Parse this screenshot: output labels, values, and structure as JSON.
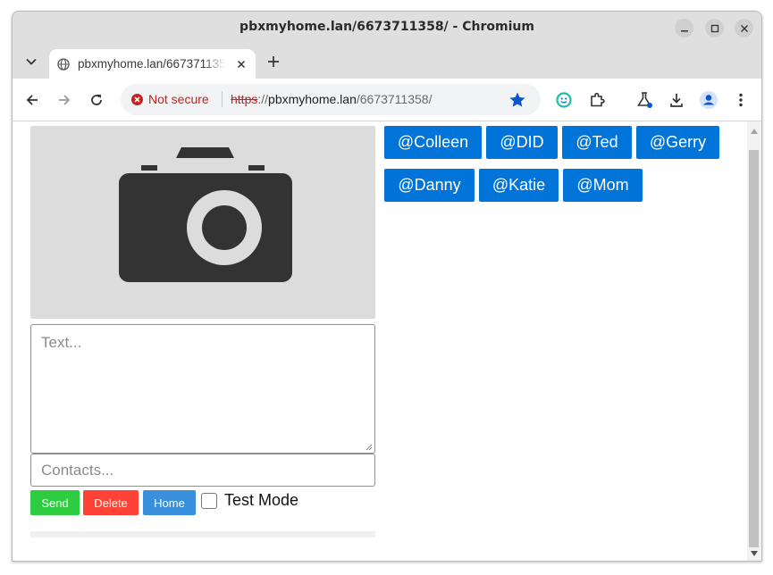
{
  "window": {
    "title": "pbxmyhome.lan/6673711358/ - Chromium",
    "controls": [
      "minimize-icon",
      "maximize-icon",
      "close-icon"
    ]
  },
  "tab": {
    "title": "pbxmyhome.lan/6673711358/"
  },
  "address_bar": {
    "security_label": "Not secure",
    "url_scheme": "https",
    "url_separator": "://",
    "url_host": "pbxmyhome.lan",
    "url_path": "/6673711358/"
  },
  "toolbar_icons": [
    "back-arrow-icon",
    "forward-arrow-icon",
    "reload-icon",
    "bookmark-star-icon",
    "extension-icon",
    "puzzle-extensions-icon",
    "labs-flask-icon",
    "download-icon",
    "profile-icon",
    "menu-kebab-icon"
  ],
  "form": {
    "text_placeholder": "Text...",
    "contacts_placeholder": "Contacts...",
    "send_label": "Send",
    "delete_label": "Delete",
    "home_label": "Home",
    "test_mode_label": "Test Mode",
    "test_mode_checked": false
  },
  "contacts": [
    "@Colleen",
    "@DID",
    "@Ted",
    "@Gerry",
    "@Danny",
    "@Katie",
    "@Mom"
  ],
  "colors": {
    "send": "#2ecc40",
    "delete": "#ff4136",
    "home": "#3a8fdd",
    "contact_chip": "#0074d9",
    "not_secure": "#c5221f",
    "star": "#0b57d0"
  }
}
